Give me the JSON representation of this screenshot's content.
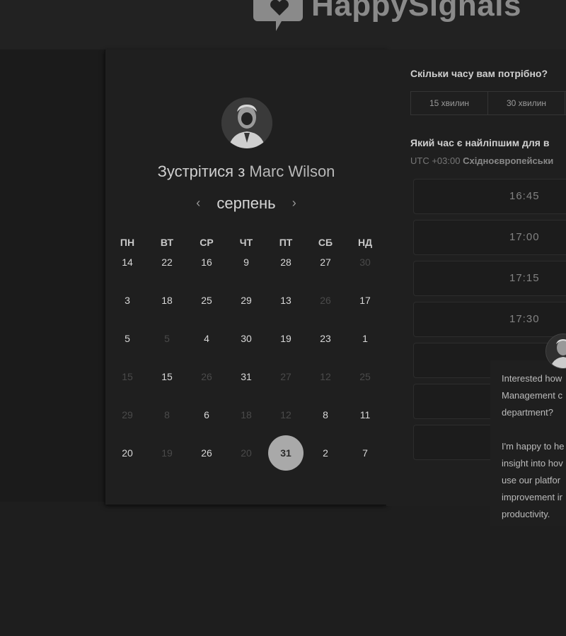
{
  "brand": {
    "logo_text": "HappySignals"
  },
  "calendar": {
    "title_prefix": "Зустрітися з",
    "host_name": "Marc Wilson",
    "month": "серпень",
    "prev_icon": "‹",
    "next_icon": "›",
    "weekdays": [
      "ПН",
      "ВТ",
      "СР",
      "ЧТ",
      "ПТ",
      "СБ",
      "НД"
    ],
    "rows": [
      [
        {
          "d": "14"
        },
        {
          "d": "22"
        },
        {
          "d": "16"
        },
        {
          "d": "9"
        },
        {
          "d": "28"
        },
        {
          "d": "27"
        },
        {
          "d": "30",
          "muted": true
        }
      ],
      [
        {
          "d": "3"
        },
        {
          "d": "18"
        },
        {
          "d": "25"
        },
        {
          "d": "29"
        },
        {
          "d": "13"
        },
        {
          "d": "26",
          "muted": true
        },
        {
          "d": "17"
        }
      ],
      [
        {
          "d": "5"
        },
        {
          "d": "5",
          "muted": true
        },
        {
          "d": "4"
        },
        {
          "d": "30"
        },
        {
          "d": "19"
        },
        {
          "d": "23"
        },
        {
          "d": "1"
        }
      ],
      [
        {
          "d": "15",
          "muted": true
        },
        {
          "d": "15"
        },
        {
          "d": "26",
          "muted": true
        },
        {
          "d": "31"
        },
        {
          "d": "27",
          "muted": true
        },
        {
          "d": "12",
          "muted": true
        },
        {
          "d": "25",
          "muted": true
        }
      ],
      [
        {
          "d": "29",
          "muted": true
        },
        {
          "d": "8",
          "muted": true
        },
        {
          "d": "6"
        },
        {
          "d": "18",
          "muted": true
        },
        {
          "d": "12",
          "muted": true
        },
        {
          "d": "8"
        },
        {
          "d": "11"
        }
      ],
      [
        {
          "d": "20"
        },
        {
          "d": "19",
          "muted": true
        },
        {
          "d": "26"
        },
        {
          "d": "20",
          "muted": true
        },
        {
          "d": "31",
          "selected": true
        },
        {
          "d": "2"
        },
        {
          "d": "7"
        }
      ]
    ]
  },
  "booking": {
    "duration_question": "Скільки часу вам потрібно?",
    "durations": [
      "15 хвилин",
      "30 хвилин"
    ],
    "time_question": "Який час є найліпшим для в",
    "timezone_offset": "UTC +03:00",
    "timezone_name": "Східноєвропейськи",
    "slots": [
      "16:45",
      "17:00",
      "17:15",
      "17:30"
    ]
  },
  "chat": {
    "line1": "Interested how",
    "line2": "Management c",
    "line3": "department?",
    "line4": "I'm happy to he",
    "line5": "insight into hov",
    "line6": "use our platfor",
    "line7": "improvement ir",
    "line8": "productivity."
  }
}
